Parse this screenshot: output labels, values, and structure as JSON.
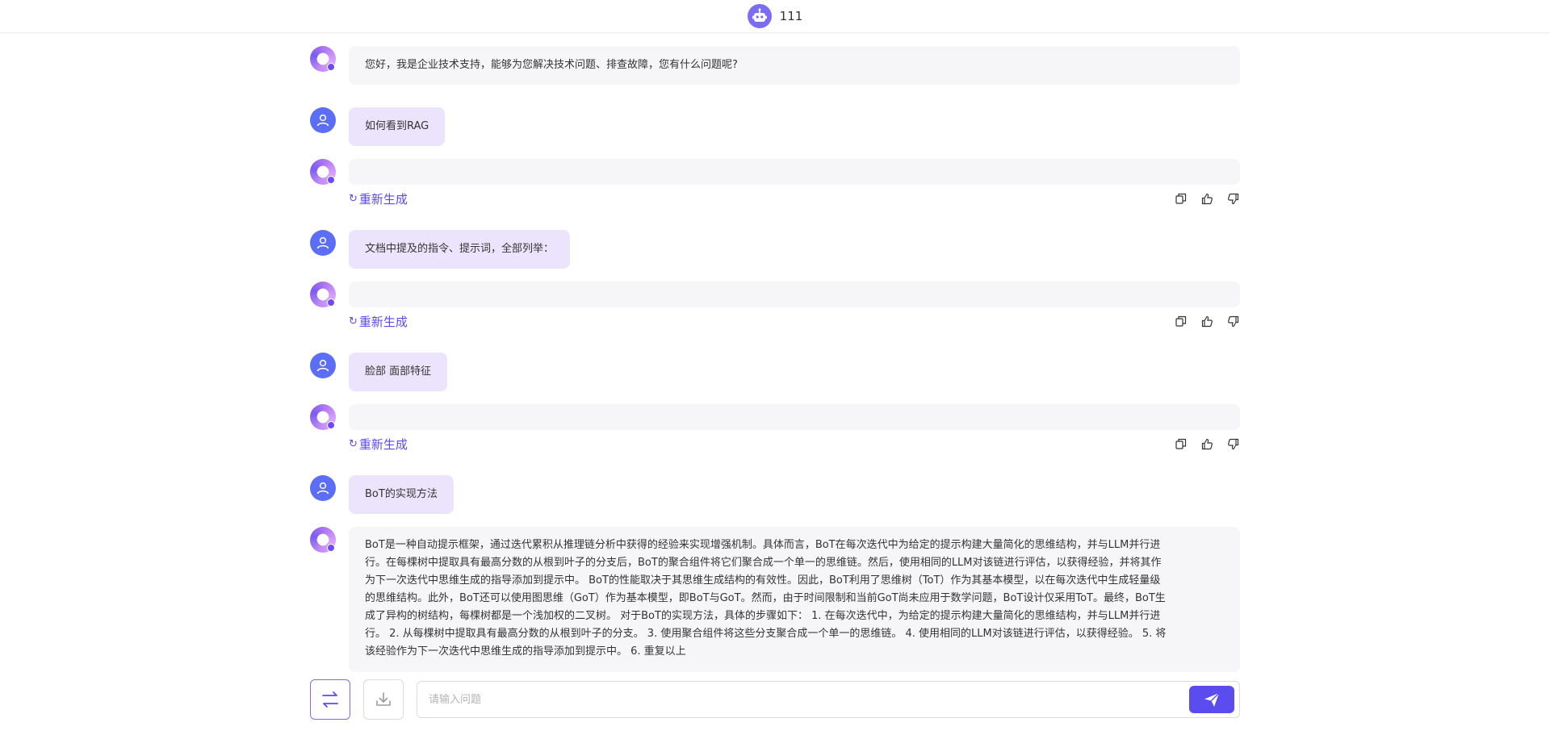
{
  "header": {
    "bot_name": "111",
    "bot_avatar_icon": "robot-icon"
  },
  "messages": [
    {
      "role": "ai",
      "text": "您好，我是企业技术支持，能够为您解决技术问题、排查故障，您有什么问题呢?"
    },
    {
      "role": "user",
      "text": "如何看到RAG"
    },
    {
      "role": "ai",
      "text": "",
      "regenerate_label": "重新生成"
    },
    {
      "role": "user",
      "text": "文档中提及的指令、提示词，全部列举："
    },
    {
      "role": "ai",
      "text": "",
      "regenerate_label": "重新生成"
    },
    {
      "role": "user",
      "text": "脸部 面部特征"
    },
    {
      "role": "ai",
      "text": "",
      "regenerate_label": "重新生成"
    },
    {
      "role": "user",
      "text": "BoT的实现方法"
    },
    {
      "role": "ai",
      "lines": [
        "BoT是一种自动提示框架，通过迭代累积从推理链分析中获得的经验来实现增强机制。具体而言，BoT在每次迭代中为给定的提示构建大量简化的思维结构，并与LLM并行进",
        "行。在每棵树中提取具有最高分数的从根到叶子的分支后，BoT的聚合组件将它们聚合成一个单一的思维链。然后，使用相同的LLM对该链进行评估，以获得经验，并将其作",
        "为下一次迭代中思维生成的指导添加到提示中。 BoT的性能取决于其思维生成结构的有效性。因此，BoT利用了思维树（ToT）作为其基本模型，以在每次迭代中生成轻量级",
        "的思维结构。此外，BoT还可以使用图思维（GoT）作为基本模型，即BoT与GoT。然而，由于时间限制和当前GoT尚未应用于数学问题，BoT设计仅采用ToT。最终，BoT生",
        "成了异构的树结构，每棵树都是一个浅加权的二叉树。 对于BoT的实现方法，具体的步骤如下： 1. 在每次迭代中，为给定的提示构建大量简化的思维结构，并与LLM并行进",
        "行。 2. 从每棵树中提取具有最高分数的从根到叶子的分支。 3. 使用聚合组件将这些分支聚合成一个单一的思维链。 4. 使用相同的LLM对该链进行评估，以获得经验。 5. 将",
        "该经验作为下一次迭代中思维生成的指导添加到提示中。 6. 重复以上"
      ]
    }
  ],
  "action_icons": [
    "copy-icon",
    "thumbs-up-icon",
    "thumbs-down-icon"
  ],
  "input": {
    "placeholder": "请输入问题"
  }
}
